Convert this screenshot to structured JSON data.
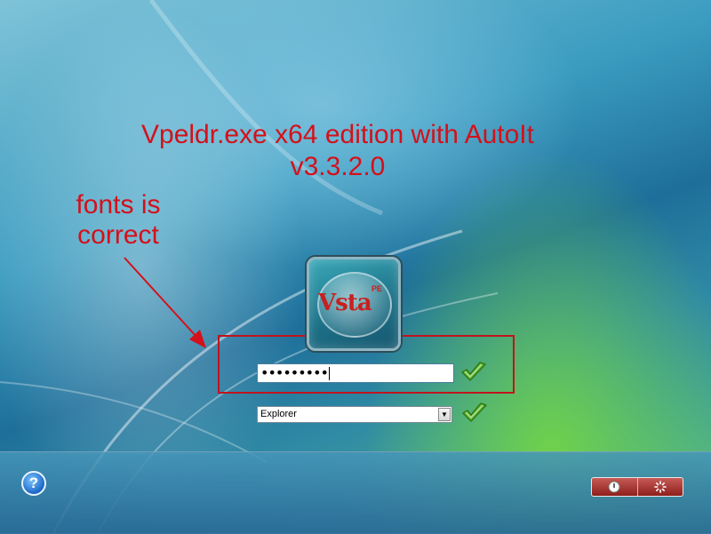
{
  "annotation": {
    "title_line1": "Vpeldr.exe x64 edition with AutoIt",
    "title_line2": "v3.3.2.0",
    "note_line1": "fonts is",
    "note_line2": "correct"
  },
  "logo": {
    "text": "Vsta",
    "superscript": "PE"
  },
  "login": {
    "password_value": "•••••••••",
    "shell_selected": "Explorer"
  },
  "icons": {
    "help": "help-icon",
    "password_submit": "checkmark-icon",
    "shell_submit": "checkmark-icon",
    "power": "power-icon",
    "restart": "restart-icon"
  },
  "help_glyph": "?",
  "colors": {
    "annotation_red": "#d4101a",
    "check_green": "#5cb82e",
    "power_red": "#a63430"
  }
}
